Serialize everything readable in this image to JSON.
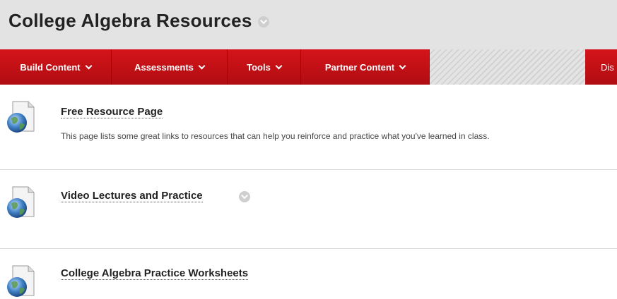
{
  "header": {
    "title": "College Algebra Resources"
  },
  "toolbar": {
    "build_content": "Build Content",
    "assessments": "Assessments",
    "tools": "Tools",
    "partner_content": "Partner Content",
    "right_cut": "Dis"
  },
  "colors": {
    "toolbar_red": "#c41016",
    "header_gray": "#e3e3e3"
  },
  "items": [
    {
      "title": "Free Resource Page",
      "description": "This page lists some great links to resources that can help you reinforce and practice what you've learned in class.",
      "icon": "web-link-icon"
    },
    {
      "title": "Video Lectures and Practice",
      "description": "",
      "icon": "web-link-icon"
    },
    {
      "title": "College Algebra Practice Worksheets",
      "description": "",
      "icon": "web-link-icon"
    }
  ]
}
